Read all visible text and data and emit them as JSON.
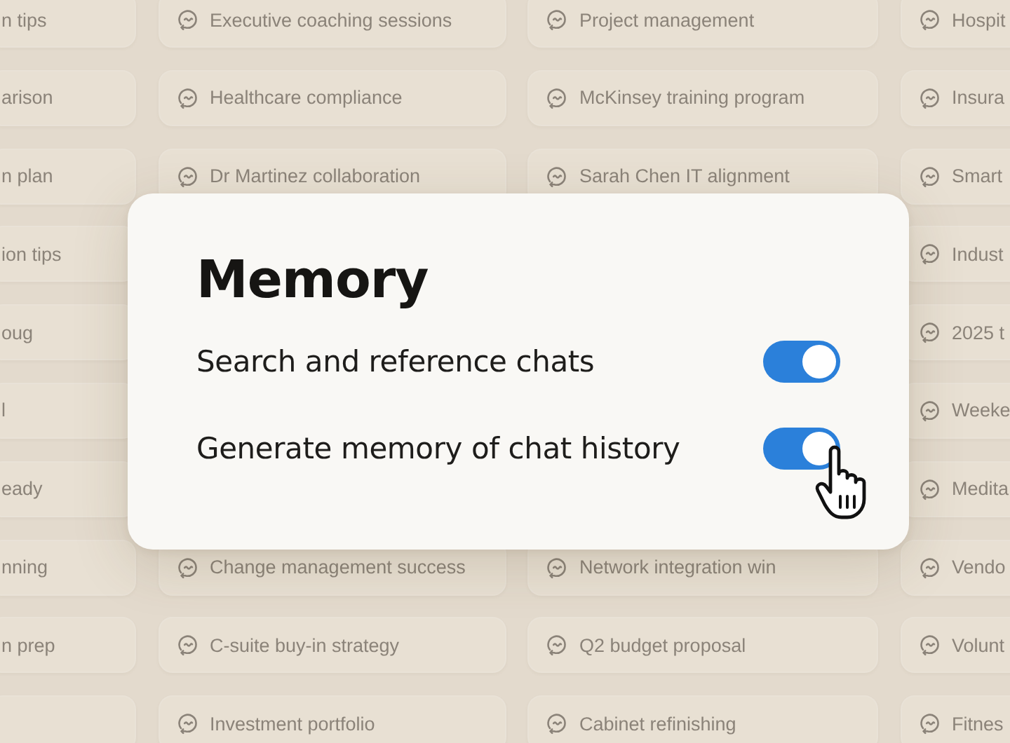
{
  "chats": [
    {
      "cells": [
        {
          "title": "n tips"
        },
        {
          "title": "Executive coaching sessions"
        },
        {
          "title": "Project management"
        },
        {
          "title": "Hospit"
        }
      ]
    },
    {
      "cells": [
        {
          "title": "arison"
        },
        {
          "title": "Healthcare compliance"
        },
        {
          "title": "McKinsey training program"
        },
        {
          "title": "Insura"
        }
      ]
    },
    {
      "cells": [
        {
          "title": "n plan"
        },
        {
          "title": "Dr Martinez collaboration"
        },
        {
          "title": "Sarah Chen IT alignment"
        },
        {
          "title": "Smart"
        }
      ]
    },
    {
      "cells": [
        {
          "title": "ion tips"
        },
        null,
        null,
        {
          "title": "Indust"
        }
      ]
    },
    {
      "cells": [
        {
          "title": "oug"
        },
        null,
        null,
        {
          "title": "2025 t"
        }
      ]
    },
    {
      "cells": [
        {
          "title": "l"
        },
        null,
        null,
        {
          "title": "Weeke"
        }
      ]
    },
    {
      "cells": [
        {
          "title": "eady"
        },
        null,
        null,
        {
          "title": "Medita"
        }
      ]
    },
    {
      "cells": [
        {
          "title": "nning"
        },
        {
          "title": "Change management success"
        },
        {
          "title": "Network integration win"
        },
        {
          "title": "Vendo"
        }
      ]
    },
    {
      "cells": [
        {
          "title": "n prep"
        },
        {
          "title": "C-suite buy-in strategy"
        },
        {
          "title": "Q2 budget proposal"
        },
        {
          "title": "Volunt"
        }
      ]
    },
    {
      "cells": [
        {},
        {
          "title": "Investment portfolio"
        },
        {
          "title": "Cabinet refinishing"
        },
        {
          "title": "Fitnes"
        }
      ]
    }
  ],
  "dialog": {
    "title": "Memory",
    "settings": [
      {
        "label": "Search and reference chats",
        "on": true
      },
      {
        "label": "Generate memory of chat history",
        "on": true
      }
    ]
  }
}
